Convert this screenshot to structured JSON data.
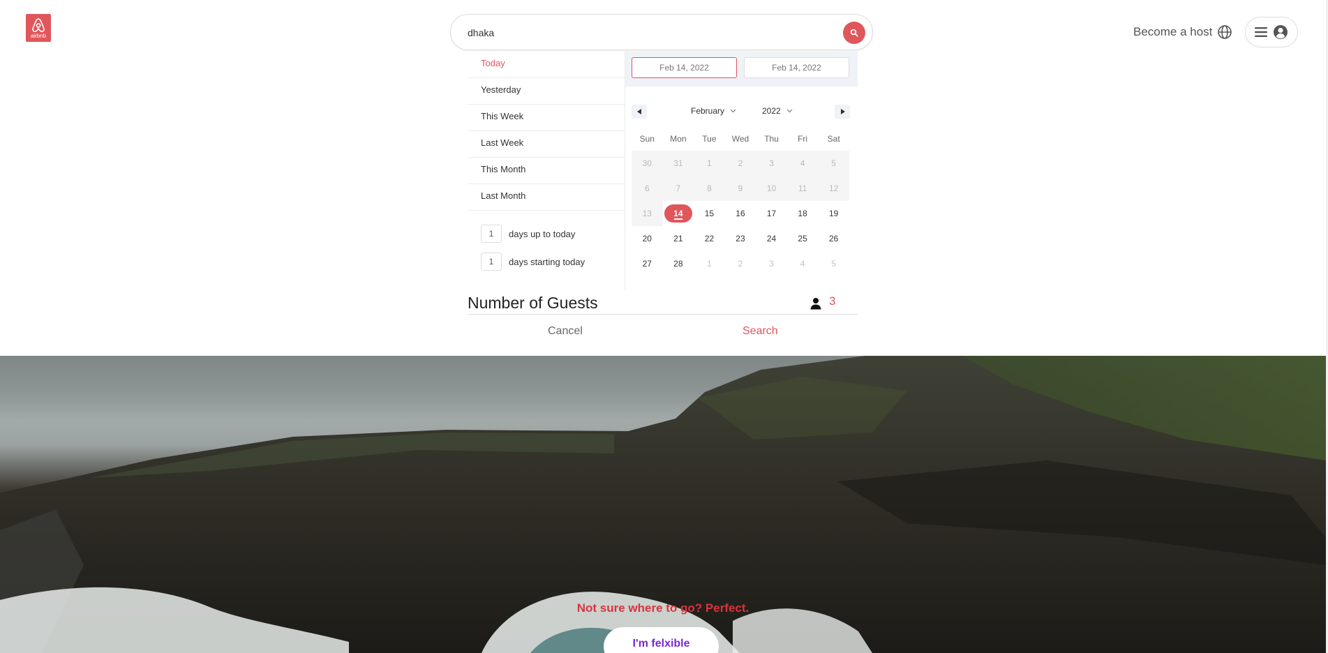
{
  "brand": {
    "logo_text": "airbnb",
    "accent_color": "#e0565b"
  },
  "search": {
    "value": "dhaka",
    "icon": "search-icon"
  },
  "nav": {
    "become_host": "Become a host",
    "globe_icon": "globe-icon",
    "menu_icon": "hamburger-icon",
    "avatar_icon": "user-circle-icon"
  },
  "date_picker": {
    "static_ranges": [
      "Today",
      "Yesterday",
      "This Week",
      "Last Week",
      "This Month",
      "Last Month"
    ],
    "active_range": "Today",
    "input_ranges": [
      {
        "value": "1",
        "label": "days up to today"
      },
      {
        "value": "1",
        "label": "days starting today"
      }
    ],
    "start_date": "Feb 14, 2022",
    "end_date": "Feb 14, 2022",
    "month": "February",
    "year": "2022",
    "weekdays": [
      "Sun",
      "Mon",
      "Tue",
      "Wed",
      "Thu",
      "Fri",
      "Sat"
    ],
    "weeks": [
      [
        "30",
        "31",
        "1",
        "2",
        "3",
        "4",
        "5"
      ],
      [
        "6",
        "7",
        "8",
        "9",
        "10",
        "11",
        "12"
      ],
      [
        "13",
        "14",
        "15",
        "16",
        "17",
        "18",
        "19"
      ],
      [
        "20",
        "21",
        "22",
        "23",
        "24",
        "25",
        "26"
      ],
      [
        "27",
        "28",
        "1",
        "2",
        "3",
        "4",
        "5"
      ]
    ],
    "selected_day": "14"
  },
  "guests": {
    "title": "Number of Guests",
    "count": "3",
    "icon": "person-icon"
  },
  "actions": {
    "cancel": "Cancel",
    "search": "Search"
  },
  "hero": {
    "tagline": "Not sure where to go? Perfect.",
    "cta": "I'm felxible"
  }
}
